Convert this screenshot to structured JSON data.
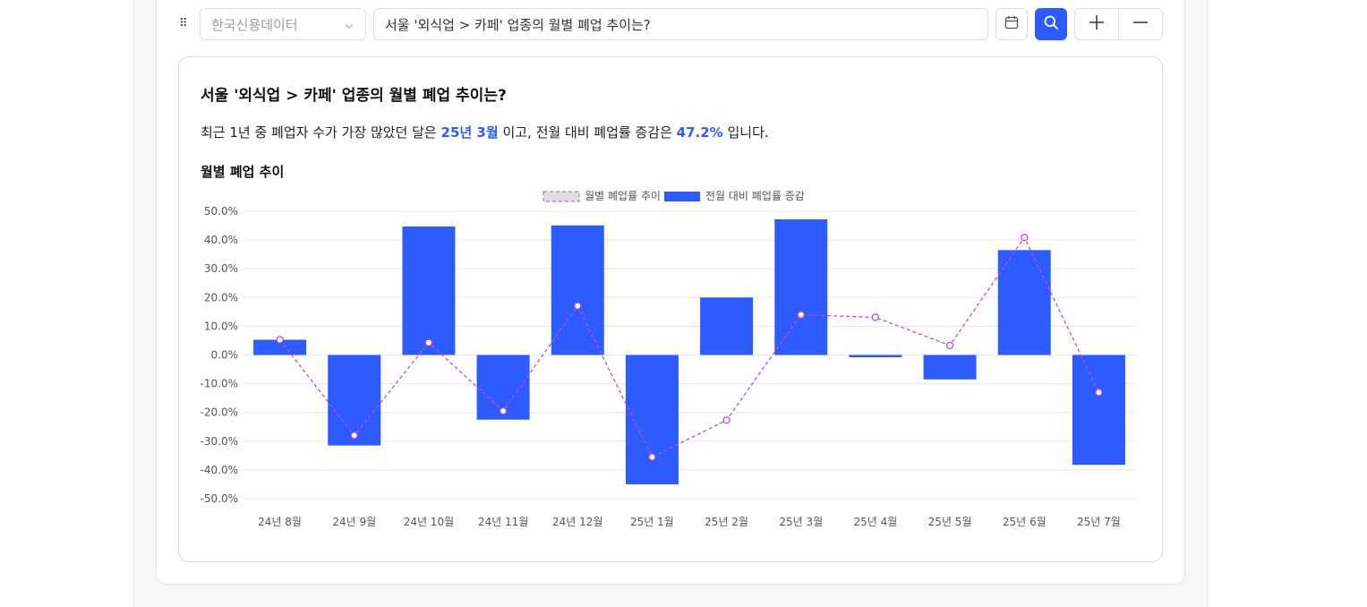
{
  "toolbar": {
    "data_source": "한국신용데이터",
    "query": "서울 '외식업 > 카페' 업종의 월별 폐업 추이는?",
    "drag_icon": "⠿",
    "icons": [
      "drag-handle-icon",
      "chevron-down-icon",
      "calendar-icon",
      "search-icon",
      "plus-icon",
      "minus-icon"
    ]
  },
  "card": {
    "title": "서울 '외식업 > 카페' 업종의 월별 폐업 추이는?",
    "summary": {
      "prefix": "최근 1년 중 폐업자 수가 가장 많았던 달은",
      "month": "25년 3월",
      "middle": "이고, 전월 대비 폐업률 증감은",
      "rate": "47.2%",
      "suffix": "입니다."
    },
    "chart_title": "월별 폐업 추이"
  },
  "colors": {
    "accent": "#2d5bff",
    "line": "#b84fe0"
  },
  "chart_data": {
    "type": "bar",
    "categories": [
      "24년 8월",
      "24년 9월",
      "24년 10월",
      "24년 11월",
      "24년 12월",
      "25년 1월",
      "25년 2월",
      "25년 3월",
      "25년 4월",
      "25년 5월",
      "25년 6월",
      "25년 7월"
    ],
    "series": [
      {
        "name": "월별 폐업률 추이",
        "type": "line",
        "style": "dashed",
        "values": [
          5.3,
          -28.0,
          4.3,
          -19.5,
          17.1,
          -35.5,
          -22.7,
          14.0,
          13.1,
          3.3,
          40.9,
          -13.0
        ]
      },
      {
        "name": "전월 대비 폐업률 증감",
        "type": "bar",
        "values": [
          5.3,
          -31.5,
          44.7,
          -22.5,
          45.1,
          -45.0,
          20.0,
          47.2,
          -0.8,
          -8.5,
          36.5,
          -38.2
        ]
      }
    ],
    "ylim": [
      -50,
      50
    ],
    "yticks": [
      "50.0%",
      "40.0%",
      "30.0%",
      "20.0%",
      "10.0%",
      "0.0%",
      "-10.0%",
      "-20.0%",
      "-30.0%",
      "-40.0%",
      "-50.0%"
    ],
    "ytick_values": [
      50,
      40,
      30,
      20,
      10,
      0,
      -10,
      -20,
      -30,
      -40,
      -50
    ],
    "grid": true,
    "legend": "top-center"
  }
}
